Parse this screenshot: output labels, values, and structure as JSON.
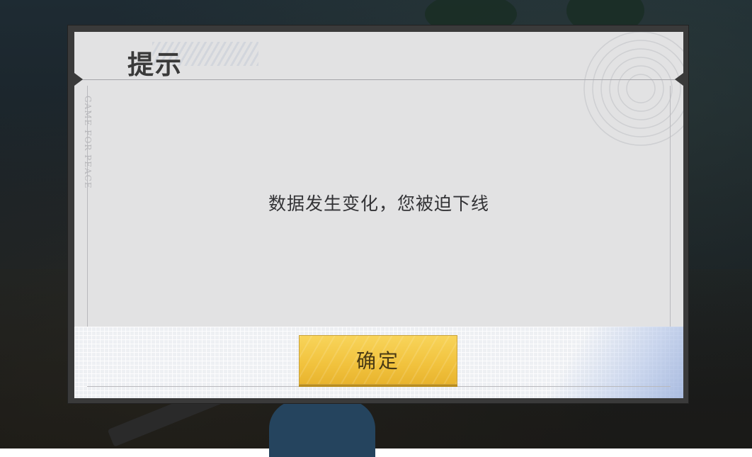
{
  "dialog": {
    "title": "提示",
    "message": "数据发生变化，您被迫下线",
    "watermark": "GAME FOR PEACE",
    "confirm_label": "确定"
  },
  "colors": {
    "button_yellow": "#f1c23d",
    "dialog_frame": "#3a3a3a",
    "dialog_surface": "#e2e2e3"
  }
}
